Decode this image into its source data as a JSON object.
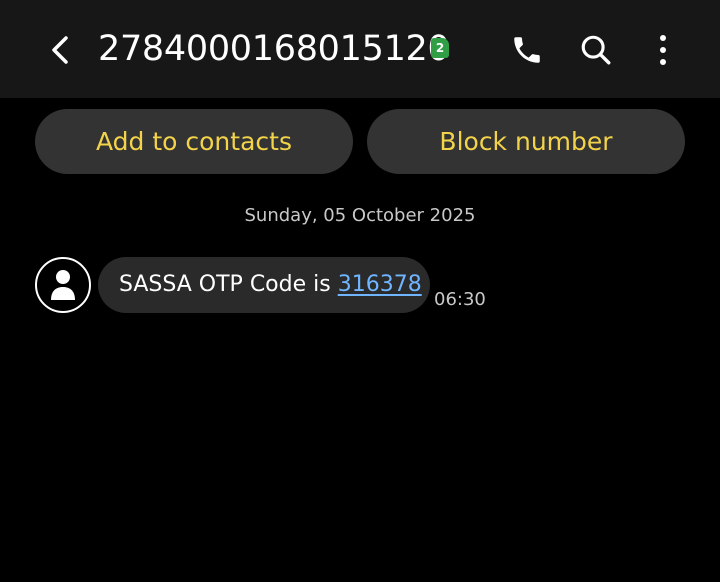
{
  "header": {
    "title": "2784000168015120",
    "sim_badge": "2",
    "back_icon": "chevron-left-icon",
    "call_icon": "phone-icon",
    "search_icon": "search-icon",
    "more_icon": "more-vertical-icon"
  },
  "actions": {
    "add_contacts_label": "Add to contacts",
    "block_number_label": "Block number"
  },
  "conversation": {
    "date": "Sunday, 05 October 2025",
    "messages": [
      {
        "text_prefix": "SASSA OTP Code is ",
        "code": "316378",
        "time": "06:30"
      }
    ]
  },
  "colors": {
    "background": "#000000",
    "header": "#171717",
    "button": "#333333",
    "button_text": "#f3d34a",
    "bubble": "#2a2a2a",
    "link": "#6fb5ff",
    "sim_badge": "#2f9e44"
  }
}
